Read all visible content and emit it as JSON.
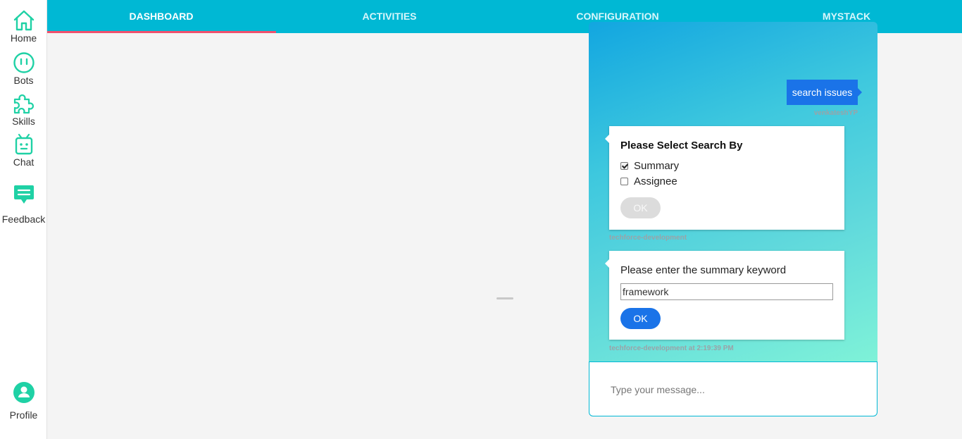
{
  "sidebar": {
    "items": [
      {
        "label": "Home",
        "icon": "home-icon"
      },
      {
        "label": "Bots",
        "icon": "bots-icon"
      },
      {
        "label": "Skills",
        "icon": "puzzle-icon"
      },
      {
        "label": "Chat",
        "icon": "robot-icon"
      },
      {
        "label": "Feedback",
        "icon": "feedback-icon"
      }
    ],
    "profile": {
      "label": "Profile",
      "icon": "user-icon"
    }
  },
  "nav": {
    "tabs": [
      {
        "label": "DASHBOARD",
        "active": true
      },
      {
        "label": "ACTIVITIES",
        "active": false
      },
      {
        "label": "CONFIGURATION",
        "active": false
      },
      {
        "label": "MYSTACK",
        "active": false
      }
    ]
  },
  "chat": {
    "user_message": {
      "text": "search issues",
      "author": "venkateshYP"
    },
    "search_card": {
      "title": "Please Select Search By",
      "options": [
        {
          "label": "Summary",
          "checked": true
        },
        {
          "label": "Assignee",
          "checked": false
        }
      ],
      "ok_label": "OK",
      "author": "techforce-development"
    },
    "keyword_card": {
      "prompt": "Please enter the summary keyword",
      "input_value": "framework",
      "ok_label": "OK",
      "author": "techforce-development at 2:19:39 PM"
    },
    "composer": {
      "placeholder": "Type your message..."
    }
  },
  "colors": {
    "accent": "#00b8d4",
    "icon": "#1fd1a5",
    "active_tab_indicator": "#f0506e",
    "button_primary": "#1a73e8"
  }
}
